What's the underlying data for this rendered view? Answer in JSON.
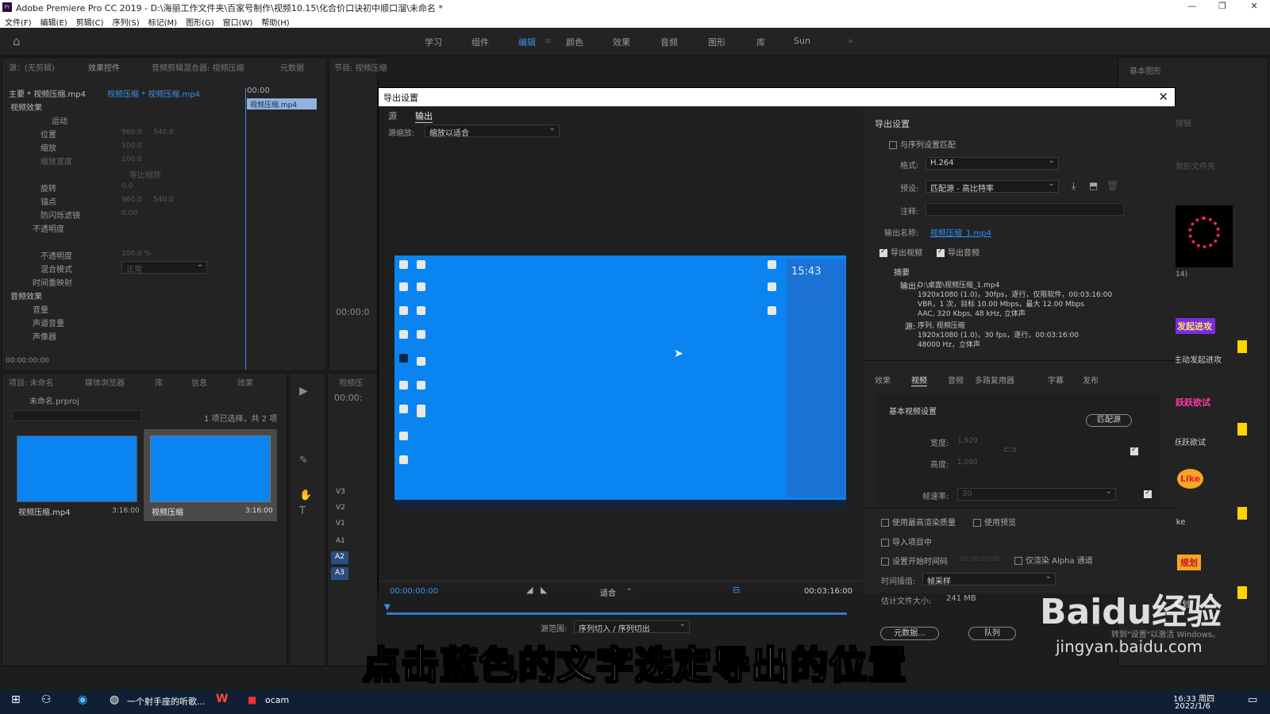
{
  "app": {
    "title": "Adobe Premiere Pro CC 2019 - D:\\海丽工作文件夹\\百家号制作\\视频10.15\\化合价口诀初中顺口溜\\未命名 *",
    "logo": "Pr"
  },
  "menu": [
    "文件(F)",
    "编辑(E)",
    "剪辑(C)",
    "序列(S)",
    "标记(M)",
    "图形(G)",
    "窗口(W)",
    "帮助(H)"
  ],
  "workspaces": [
    "学习",
    "组件",
    "编辑",
    "颜色",
    "效果",
    "音频",
    "图形",
    "库",
    "Sun"
  ],
  "active_workspace": "编辑",
  "effect_controls": {
    "tabs": [
      "源：(无剪辑)",
      "效果控件",
      "音频剪辑混合器: 视频压缩",
      "元数据"
    ],
    "clip_master": "主要 * 视频压缩.mp4",
    "clip_seq": "视频压缩 * 视频压缩.mp4",
    "timecode_start": "00:00",
    "clip_bar": "视频压缩.mp4",
    "video_effects_label": "视频效果",
    "motion_label": "运动",
    "rows": [
      {
        "name": "位置",
        "v1": "960.0",
        "v2": "540.0"
      },
      {
        "name": "缩放",
        "v1": "100.0",
        "v2": ""
      },
      {
        "name": "缩放宽度",
        "v1": "100.0",
        "v2": ""
      },
      {
        "name": "等比缩放",
        "v1": "",
        "v2": ""
      },
      {
        "name": "旋转",
        "v1": "0.0",
        "v2": ""
      },
      {
        "name": "锚点",
        "v1": "960.0",
        "v2": "540.0"
      },
      {
        "name": "防闪烁滤镜",
        "v1": "0.00",
        "v2": ""
      }
    ],
    "opacity_label": "不透明度",
    "opacity_row": {
      "name": "不透明度",
      "v1": "100.0 %"
    },
    "blend_row": {
      "name": "混合模式",
      "v1": "正常"
    },
    "time_remap": "时间重映射",
    "audio_effects_label": "音频效果",
    "audio_rows": [
      "音量",
      "声道音量",
      "声像器"
    ],
    "bottom_time": "00:00:00:00"
  },
  "program": {
    "tab": "节目: 视频压缩",
    "timecode": "00:00:0"
  },
  "project": {
    "tabs": [
      "项目: 未命名",
      "媒体浏览器",
      "库",
      "信息",
      "效果"
    ],
    "file": "未命名.prproj",
    "selection": "1 项已选择，共 2 项",
    "items": [
      {
        "name": "视频压缩.mp4",
        "duration": "3:16:00"
      },
      {
        "name": "视频压缩",
        "duration": "3:16:00"
      }
    ]
  },
  "timeline": {
    "tab": "视频压",
    "timecode": "00:00:",
    "tracks": [
      "V3",
      "V2",
      "V1",
      "A1",
      "A2",
      "A3"
    ]
  },
  "export": {
    "title": "导出设置",
    "tabs": [
      "源",
      "输出"
    ],
    "active_tab": "输出",
    "source_scale_label": "源缩放:",
    "source_scale_value": "缩放以适合",
    "time_start": "00:00:00:00",
    "time_end": "00:03:16:00",
    "fit_value": "适合",
    "source_range_label": "源范围:",
    "source_range_value": "序列切入 / 序列切出",
    "preview_clock": "15:43",
    "settings": {
      "header": "导出设置",
      "match_seq": "与序列设置匹配",
      "format_label": "格式:",
      "format_value": "H.264",
      "preset_label": "预设:",
      "preset_value": "匹配源 - 高比特率",
      "comment_label": "注释:",
      "output_name_label": "输出名称:",
      "output_name_value": "视频压缩_1.mp4",
      "export_video": "导出视频",
      "export_audio": "导出音频",
      "summary_header": "摘要",
      "output_label": "输出:",
      "output_lines": [
        "D:\\桌面\\视频压缩_1.mp4",
        "1920x1080 (1.0)，30fps，逐行，仅限软件，00:03:16:00",
        "VBR，1 次，目标 10.00 Mbps，最大 12.00 Mbps",
        "AAC, 320 Kbps, 48 kHz, 立体声"
      ],
      "source_label": "源:",
      "source_lines": [
        "序列, 视频压缩",
        "1920x1080 (1.0)，30 fps，逐行，00:03:16:00",
        "48000 Hz，立体声"
      ]
    },
    "subtabs": [
      "效果",
      "视频",
      "音频",
      "多路复用器",
      "字幕",
      "发布"
    ],
    "active_subtab": "视频",
    "video_basic": {
      "header": "基本视频设置",
      "match_btn": "匹配源",
      "width_label": "宽度:",
      "width_value": "1,920",
      "height_label": "高度:",
      "height_value": "1,080",
      "fps_label": "帧速率:",
      "fps_value": "30"
    },
    "options": {
      "max_quality": "使用最高渲染质量",
      "use_preview": "使用预览",
      "import_project": "导入项目中",
      "set_start_tc": "设置开始时间码",
      "start_tc_value": "00:00:00:00",
      "alpha_only": "仅渲染 Alpha 通道",
      "interp_label": "时间插值:",
      "interp_value": "帧采样",
      "filesize_label": "估计文件大小:",
      "filesize_value": "241 MB",
      "metadata_btn": "元数据...",
      "queue_btn": "队列"
    }
  },
  "right_panel": {
    "tab": "基本图形",
    "search_placeholder": "搜模",
    "folder_label": "我的文件夹",
    "count": "14)",
    "stickers": [
      {
        "text": "发起进攻",
        "label": "主动发起进攻"
      },
      {
        "text": "跃跃欲试",
        "label": "跃跃欲试"
      },
      {
        "text": "Like",
        "label": "ike"
      },
      {
        "text": "规划",
        "label": "规划"
      }
    ],
    "accent": "#ffd400"
  },
  "caption": "点击蓝色的文字选定导出的位置",
  "watermark": {
    "brand": "Baidu经验",
    "url": "jingyan.baidu.com",
    "windows_hint": "转到\"设置\"以激活 Windows。"
  },
  "taskbar": {
    "items": [
      "一个射手座的听歌...",
      "ocam"
    ],
    "time": "16:33 周四",
    "date": "2022/1/6"
  },
  "colors": {
    "accent_blue": "#3d8fe8",
    "link_blue": "#2f8fff",
    "desktop_blue": "#0a84f0"
  }
}
